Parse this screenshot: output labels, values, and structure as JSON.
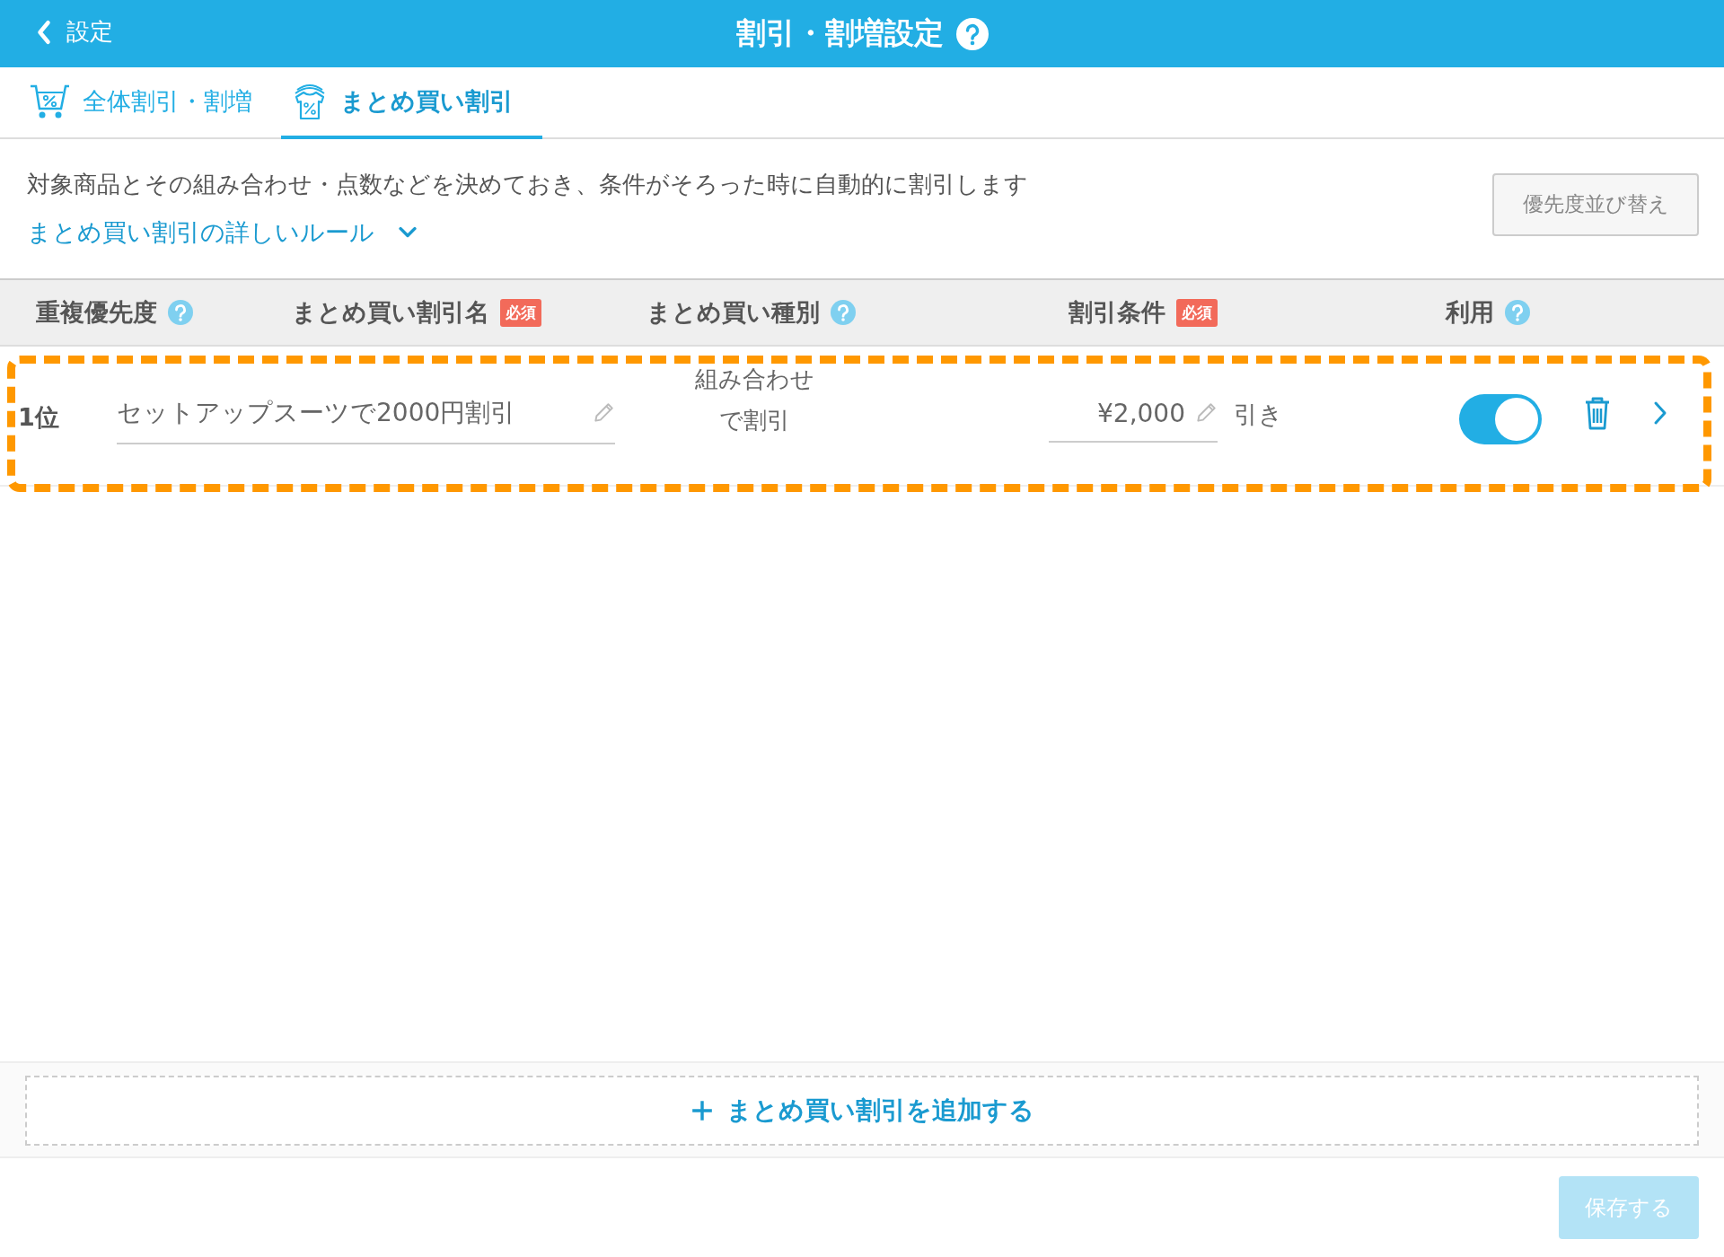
{
  "header": {
    "back_label": "設定",
    "title": "割引・割増設定"
  },
  "tabs": [
    {
      "label": "全体割引・割増",
      "selected": false,
      "kind": "cart"
    },
    {
      "label": "まとめ買い割引",
      "selected": true,
      "kind": "shirts"
    }
  ],
  "description": "対象商品とその組み合わせ・点数などを決めておき、条件がそろった時に自動的に割引します",
  "rules_link": "まとめ買い割引の詳しいルール",
  "sort_button": "優先度並び替え",
  "columns": [
    {
      "label": "重複優先度",
      "help": true
    },
    {
      "label": "まとめ買い割引名",
      "badge": "必須",
      "help": false
    },
    {
      "label": "まとめ買い種別",
      "help": true
    },
    {
      "label": "割引条件",
      "badge": "必須",
      "help": false
    },
    {
      "label": "利用",
      "help": true
    }
  ],
  "rows": [
    {
      "priority": "1位",
      "name": "セットアップスーツで2000円割引",
      "type": "組み合わせで割引",
      "amount": "¥2,000",
      "suffix": "引き",
      "on": true,
      "highlighted": true
    }
  ],
  "add_button": "まとめ買い割引を追加する",
  "save_button": {
    "label": "保存する",
    "disabled": true
  }
}
